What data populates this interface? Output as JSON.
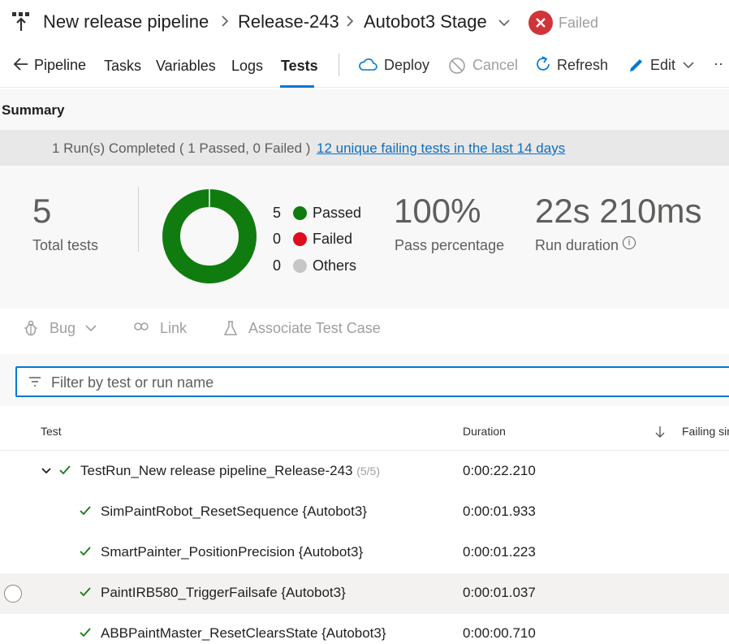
{
  "header": {
    "breadcrumbs": [
      "New release pipeline",
      "Release-243",
      "Autobot3 Stage"
    ],
    "status": "Failed",
    "icons": {
      "pipeline": "pipeline-icon",
      "status": "failed-x-icon"
    }
  },
  "nav": {
    "back_label": "Pipeline",
    "tabs": [
      "Tasks",
      "Variables",
      "Logs",
      "Tests"
    ],
    "active_tab": "Tests",
    "commands": {
      "deploy": "Deploy",
      "cancel": "Cancel",
      "refresh": "Refresh",
      "edit": "Edit",
      "more": "··"
    }
  },
  "summary": {
    "title": "Summary",
    "run_status": "1 Run(s) Completed ( 1 Passed, 0 Failed )",
    "failing_link": "12 unique failing tests in the last 14 days",
    "total_tests": "5",
    "total_label": "Total tests",
    "legend": [
      {
        "count": "5",
        "label": "Passed",
        "color": "#107c10"
      },
      {
        "count": "0",
        "label": "Failed",
        "color": "#e00b1c"
      },
      {
        "count": "0",
        "label": "Others",
        "color": "#c8c6c4"
      }
    ],
    "pass_pct": "100%",
    "pass_label": "Pass percentage",
    "duration": "22s 210ms",
    "duration_label": "Run duration",
    "info_glyph": "i"
  },
  "toolbar": {
    "bug": "Bug",
    "link": "Link",
    "associate": "Associate Test Case"
  },
  "filter": {
    "placeholder": "Filter by test or run name"
  },
  "table": {
    "headers": {
      "test": "Test",
      "duration": "Duration",
      "failing": "Failing sin"
    },
    "group": {
      "name": "TestRun_New release pipeline_Release-243",
      "count": "(5/5)",
      "duration": "0:00:22.210"
    },
    "rows": [
      {
        "name": "SimPaintRobot_ResetSequence {Autobot3}",
        "duration": "0:00:01.933"
      },
      {
        "name": "SmartPainter_PositionPrecision {Autobot3}",
        "duration": "0:00:01.223"
      },
      {
        "name": "PaintIRB580_TriggerFailsafe {Autobot3}",
        "duration": "0:00:01.037"
      },
      {
        "name": "ABBPaintMaster_ResetClearsState {Autobot3}",
        "duration": "0:00:00.710"
      }
    ]
  },
  "colors": {
    "accent": "#0078d4",
    "passed": "#107c10",
    "failed": "#d13438"
  }
}
